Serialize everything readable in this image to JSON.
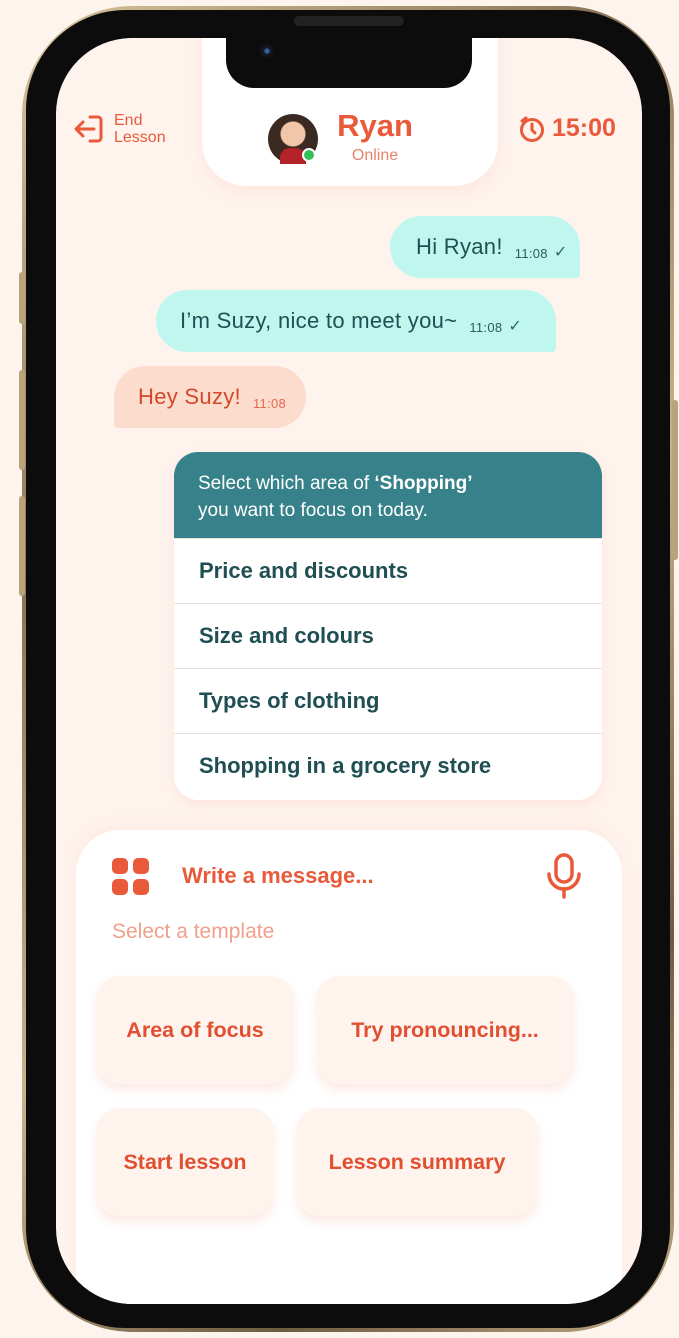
{
  "header": {
    "end_lesson": "End Lesson",
    "contact_name": "Ryan",
    "contact_status": "Online",
    "timer": "15:00"
  },
  "messages": [
    {
      "text": "Hi Ryan!",
      "time": "11:08",
      "direction": "out",
      "read": true
    },
    {
      "text": "I’m Suzy, nice to meet you~",
      "time": "11:08",
      "direction": "out",
      "read": true
    },
    {
      "text": "Hey Suzy!",
      "time": "11:08",
      "direction": "in"
    }
  ],
  "focus_prompt": {
    "prefix": "Select which area of ",
    "topic": "‘Shopping’",
    "suffix": "you want to focus on today.",
    "options": [
      "Price and discounts",
      "Size and colours",
      "Types of clothing",
      "Shopping in a grocery store"
    ]
  },
  "composer": {
    "placeholder": "Write a message...",
    "template_label": "Select a template",
    "templates": [
      "Area of focus",
      "Try pronouncing...",
      "Start lesson",
      "Lesson summary"
    ]
  },
  "colors": {
    "accent": "#e85a3a",
    "teal": "#37828a",
    "outgoing_bubble": "#bff7ef",
    "incoming_bubble": "#fcdccd",
    "background": "#fff3ee"
  }
}
